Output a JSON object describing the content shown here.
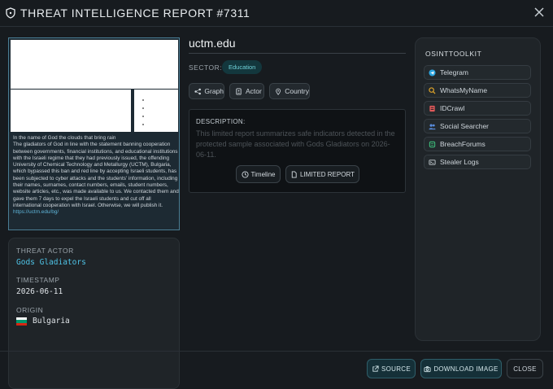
{
  "header": {
    "title": "THREAT INTELLIGENCE REPORT #7311"
  },
  "screenshot": {
    "text": "In the name of God the clouds that bring rain\nThe gladiators of God in line with the statement banning cooperation between governments, financial institutions, and educational institutions with the Israeli regime that they had previously issued, the offending University of Chemical Technology and Metallurgy (UCTM), Bulgaria, which bypassed this ban and red line by accepting Israeli students, has been subjected to cyber attacks and the students' information, including their names, surnames, contact numbers, emails, student numbers, website articles, etc., was made available to us. We contacted them and gave them 7 days to expel the Israeli students and cut off all international cooperation with Israel. Otherwise, we will publish it.",
    "link": "https://uctm.edu/bg/"
  },
  "details": {
    "threat_actor_label": "THREAT ACTOR",
    "threat_actor": "Gods Gladiators",
    "timestamp_label": "TIMESTAMP",
    "timestamp": "2026-06-11",
    "origin_label": "ORIGIN",
    "origin": "Bulgaria",
    "flag_colors": [
      "#ffffff",
      "#00966e",
      "#d62612"
    ]
  },
  "main": {
    "domain": "uctm.edu",
    "sector_label": "SECTOR:",
    "sector": "Education",
    "pills": [
      {
        "label": "Graph",
        "icon": "graph-icon"
      },
      {
        "label": "Actor",
        "icon": "id-card-icon"
      },
      {
        "label": "Country",
        "icon": "map-pin-icon"
      }
    ],
    "description_label": "DESCRIPTION:",
    "description": "This limited report summarizes safe indicators detected in the protected sample associated with Gods Gladiators on 2026-06-11.",
    "timeline_label": "Timeline",
    "limited_label": "LIMITED REPORT"
  },
  "osint": {
    "title": "OSINTTOOLKIT",
    "tools": [
      {
        "label": "Telegram",
        "icon": "telegram-icon",
        "color": "#2ca5e0"
      },
      {
        "label": "WhatsMyName",
        "icon": "search-icon",
        "color": "#e0a52a"
      },
      {
        "label": "IDCrawl",
        "icon": "id-icon",
        "color": "#e05a5a"
      },
      {
        "label": "Social Searcher",
        "icon": "users-icon",
        "color": "#5a8ee0"
      },
      {
        "label": "BreachForums",
        "icon": "database-icon",
        "color": "#3dbb7a"
      },
      {
        "label": "Stealer Logs",
        "icon": "terminal-icon",
        "color": "#c9d1d6"
      }
    ]
  },
  "footer": {
    "source_label": "SOURCE",
    "download_label": "DOWNLOAD IMAGE",
    "close_label": "CLOSE"
  }
}
